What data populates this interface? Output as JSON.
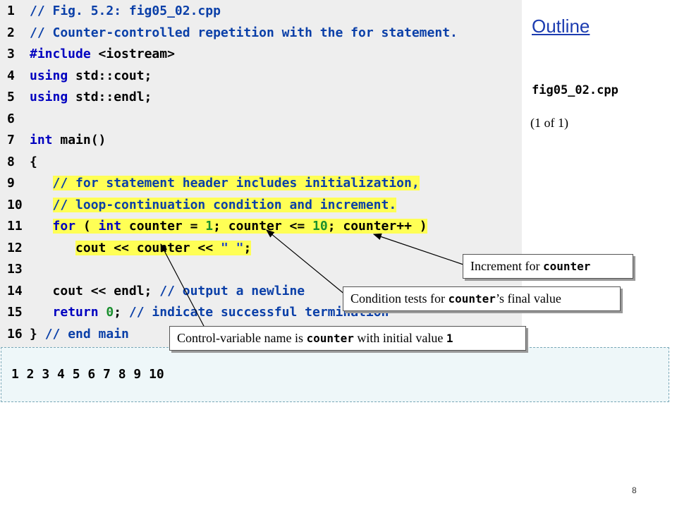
{
  "code": {
    "lines": [
      {
        "n": "1",
        "segs": [
          {
            "t": "// Fig. 5.2: fig05_02.cpp",
            "c": "cm"
          }
        ]
      },
      {
        "n": "2",
        "segs": [
          {
            "t": "// Counter-controlled repetition with the for statement.",
            "c": "cm"
          }
        ]
      },
      {
        "n": "3",
        "segs": [
          {
            "t": "#include ",
            "c": "kw"
          },
          {
            "t": "<iostream>",
            "c": ""
          }
        ]
      },
      {
        "n": "4",
        "segs": [
          {
            "t": "using",
            "c": "kw"
          },
          {
            "t": " std::cout;",
            "c": ""
          }
        ]
      },
      {
        "n": "5",
        "segs": [
          {
            "t": "using",
            "c": "kw"
          },
          {
            "t": " std::endl;",
            "c": ""
          }
        ]
      },
      {
        "n": "6",
        "segs": []
      },
      {
        "n": "7",
        "segs": [
          {
            "t": "int",
            "c": "kw"
          },
          {
            "t": " main()",
            "c": ""
          }
        ]
      },
      {
        "n": "8",
        "segs": [
          {
            "t": "{",
            "c": ""
          }
        ]
      },
      {
        "n": "9",
        "indent": "   ",
        "segs": [
          {
            "t": "// for statement header includes initialization,",
            "c": "cm hl"
          }
        ]
      },
      {
        "n": "10",
        "indent": "   ",
        "segs": [
          {
            "t": "// loop-continuation condition and increment.",
            "c": "cm hl"
          }
        ]
      },
      {
        "n": "11",
        "indent": "   ",
        "segs": [
          {
            "t": "for",
            "c": "kw hl"
          },
          {
            "t": " ( ",
            "c": "hl"
          },
          {
            "t": "int",
            "c": "kw hl"
          },
          {
            "t": " counter = ",
            "c": "hl"
          },
          {
            "t": "1",
            "c": "num hl"
          },
          {
            "t": "; counter <= ",
            "c": "hl"
          },
          {
            "t": "10",
            "c": "num hl"
          },
          {
            "t": "; counter++ )",
            "c": "hl"
          }
        ]
      },
      {
        "n": "12",
        "indent": "      ",
        "segs": [
          {
            "t": "cout << counter << ",
            "c": "hl"
          },
          {
            "t": "\" \"",
            "c": "str hl"
          },
          {
            "t": ";",
            "c": "hl"
          }
        ]
      },
      {
        "n": "13",
        "segs": []
      },
      {
        "n": "14",
        "indent": "   ",
        "segs": [
          {
            "t": "cout << endl; ",
            "c": ""
          },
          {
            "t": "// output a newline",
            "c": "cm"
          }
        ]
      },
      {
        "n": "15",
        "indent": "   ",
        "segs": [
          {
            "t": "return",
            "c": "kw"
          },
          {
            "t": " ",
            "c": ""
          },
          {
            "t": "0",
            "c": "num"
          },
          {
            "t": "; ",
            "c": ""
          },
          {
            "t": "// indicate successful termination",
            "c": "cm"
          }
        ]
      },
      {
        "n": "16",
        "segs": [
          {
            "t": "} ",
            "c": ""
          },
          {
            "t": "// end main",
            "c": "cm"
          }
        ]
      }
    ]
  },
  "output": "1 2 3 4 5 6 7 8 9 10",
  "sidebar": {
    "outline": "Outline",
    "file": "fig05_02.cpp",
    "page": "(1 of 1)"
  },
  "callouts": {
    "increment": {
      "text": "Increment for ",
      "code": "counter",
      "after": ""
    },
    "condition": {
      "text": "Condition tests for ",
      "code": "counter",
      "after": "’s final value"
    },
    "control": {
      "text": "Control-variable name is ",
      "code": "counter",
      "after": " with initial value ",
      "code2": "1"
    }
  },
  "slide_number": "8"
}
